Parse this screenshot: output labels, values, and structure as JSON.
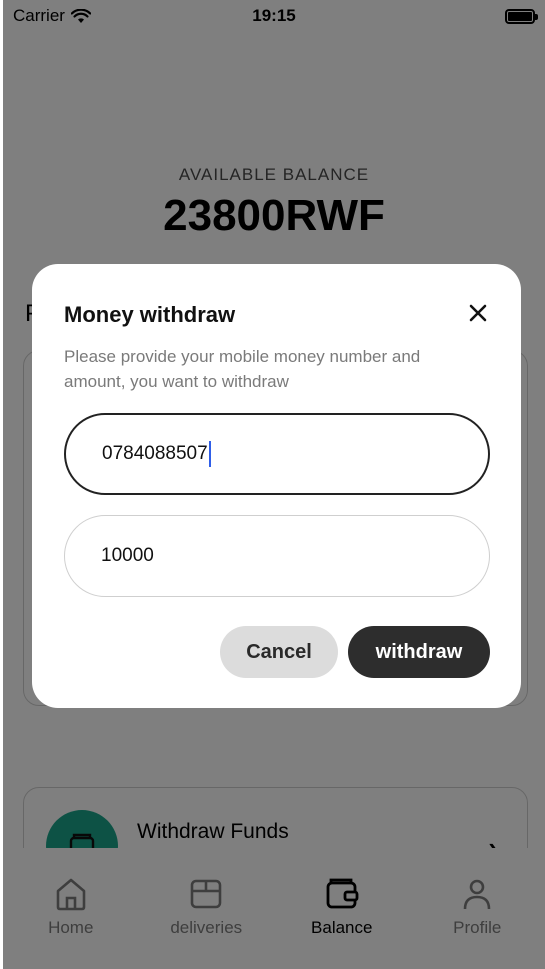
{
  "status_bar": {
    "carrier": "Carrier",
    "time": "19:15"
  },
  "balance": {
    "label": "AVAILABLE BALANCE",
    "value": "23800RWF"
  },
  "section": {
    "letter": "P"
  },
  "withdraw_card": {
    "title": "Withdraw Funds",
    "icon": "wallet-icon"
  },
  "tabs": [
    {
      "label": "Home",
      "icon": "home-icon",
      "active": false
    },
    {
      "label": "deliveries",
      "icon": "box-icon",
      "active": false
    },
    {
      "label": "Balance",
      "icon": "wallet-icon",
      "active": true
    },
    {
      "label": "Profile",
      "icon": "person-icon",
      "active": false
    }
  ],
  "dialog": {
    "title": "Money withdraw",
    "description": "Please provide your mobile money number and amount, you want to withdraw",
    "phone_value": "0784088507",
    "amount_value": "10000",
    "cancel_label": "Cancel",
    "withdraw_label": "withdraw"
  },
  "colors": {
    "accent_dark": "#2d2d2d",
    "teal": "#1aa58a",
    "caret": "#2f5ee8"
  }
}
